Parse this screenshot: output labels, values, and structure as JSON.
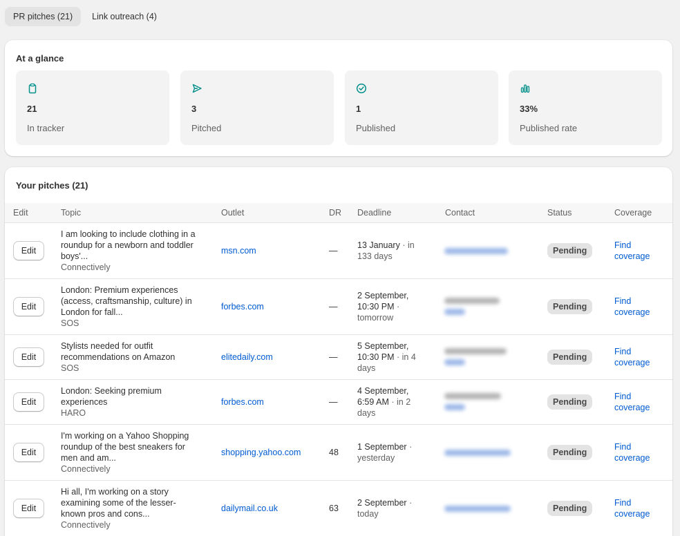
{
  "tabs": [
    {
      "label": "PR pitches (21)",
      "active": true
    },
    {
      "label": "Link outreach (4)",
      "active": false
    }
  ],
  "glance": {
    "title": "At a glance",
    "stats": [
      {
        "icon": "clipboard-icon",
        "value": "21",
        "label": "In tracker"
      },
      {
        "icon": "send-icon",
        "value": "3",
        "label": "Pitched"
      },
      {
        "icon": "check-circle-icon",
        "value": "1",
        "label": "Published"
      },
      {
        "icon": "bar-chart-icon",
        "value": "33%",
        "label": "Published rate"
      }
    ]
  },
  "pitches": {
    "title": "Your pitches (21)",
    "columns": [
      "Edit",
      "Topic",
      "Outlet",
      "DR",
      "Deadline",
      "Contact",
      "Status",
      "Coverage"
    ],
    "rows": [
      {
        "edit": "Edit",
        "topic_lines": [
          "I am looking to include clothing in a",
          "roundup for a newborn and toddler",
          "boys'..."
        ],
        "source": "Connectively",
        "outlet": "msn.com",
        "dr": "—",
        "deadline_main": "13 January",
        "deadline_rel": "· in 133 days",
        "status": "Pending",
        "coverage": "Find coverage"
      },
      {
        "edit": "Edit",
        "topic_lines": [
          "London: Premium experiences",
          "(access, craftsmanship, culture) in",
          "London for fall..."
        ],
        "source": "SOS",
        "outlet": "forbes.com",
        "dr": "—",
        "deadline_main": "2 September, 10:30 PM",
        "deadline_rel": "· tomorrow",
        "status": "Pending",
        "coverage": "Find coverage"
      },
      {
        "edit": "Edit",
        "topic_lines": [
          "Stylists needed for outfit",
          "recommendations on Amazon"
        ],
        "source": "SOS",
        "outlet": "elitedaily.com",
        "dr": "—",
        "deadline_main": "5 September, 10:30 PM",
        "deadline_rel": "· in 4 days",
        "status": "Pending",
        "coverage": "Find coverage"
      },
      {
        "edit": "Edit",
        "topic_lines": [
          "London: Seeking premium",
          "experiences"
        ],
        "source": "HARO",
        "outlet": "forbes.com",
        "dr": "—",
        "deadline_main": "4 September, 6:59 AM",
        "deadline_rel": "· in 2 days",
        "status": "Pending",
        "coverage": "Find coverage"
      },
      {
        "edit": "Edit",
        "topic_lines": [
          "I'm working on a Yahoo Shopping",
          "roundup of the best sneakers for",
          "men and am..."
        ],
        "source": "Connectively",
        "outlet": "shopping.yahoo.com",
        "dr": "48",
        "deadline_main": "1 September",
        "deadline_rel": "· yesterday",
        "status": "Pending",
        "coverage": "Find coverage"
      },
      {
        "edit": "Edit",
        "topic_lines": [
          "Hi all, I'm working on a story",
          "examining some of the lesser-",
          "known pros and cons..."
        ],
        "source": "Connectively",
        "outlet": "dailymail.co.uk",
        "dr": "63",
        "deadline_main": "2 September",
        "deadline_rel": "· today",
        "status": "Pending",
        "coverage": "Find coverage"
      }
    ]
  },
  "colors": {
    "link": "#005bd3",
    "accent": "#008f8a",
    "page_bg": "#f1f1f1"
  }
}
